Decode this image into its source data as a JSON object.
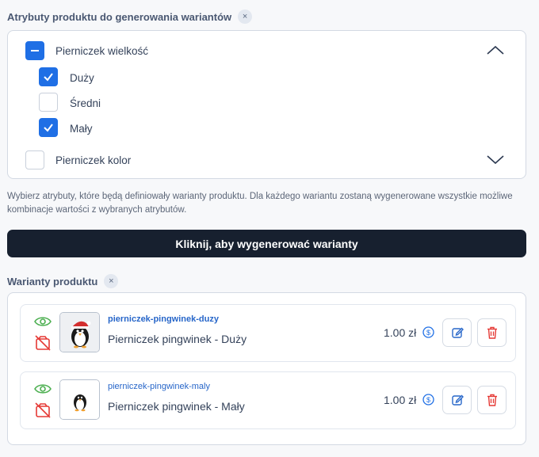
{
  "attributes": {
    "title": "Atrybuty produktu do generowania wariantów",
    "remove_badge": "×",
    "groups": [
      {
        "name": "Pierniczek wielkość",
        "state": "indeterminate",
        "expanded": true,
        "options": [
          {
            "label": "Duży",
            "checked": true
          },
          {
            "label": "Średni",
            "checked": false
          },
          {
            "label": "Mały",
            "checked": true
          }
        ]
      },
      {
        "name": "Pierniczek kolor",
        "state": "unchecked",
        "expanded": false
      }
    ]
  },
  "help_text": "Wybierz atrybuty, które będą definiowały warianty produktu. Dla każdego wariantu zostaną wygenerowane wszystkie możliwe kombinacje wartości z wybranych atrybutów.",
  "generate_button": "Kliknij, aby wygenerować warianty",
  "variants": {
    "title": "Warianty produktu",
    "remove_badge": "×",
    "items": [
      {
        "sku": "pierniczek-pingwinek-duzy",
        "name": "Pierniczek pingwinek - Duży",
        "price": "1.00 zł"
      },
      {
        "sku": "pierniczek-pingwinek-maly",
        "name": "Pierniczek pingwinek - Mały",
        "price": "1.00 zł"
      }
    ]
  },
  "colors": {
    "accent": "#1f6fe5",
    "button_dark": "#17202f",
    "visible_green": "#4caf50",
    "hidden_red": "#e53935",
    "delete_red": "#e53935"
  }
}
